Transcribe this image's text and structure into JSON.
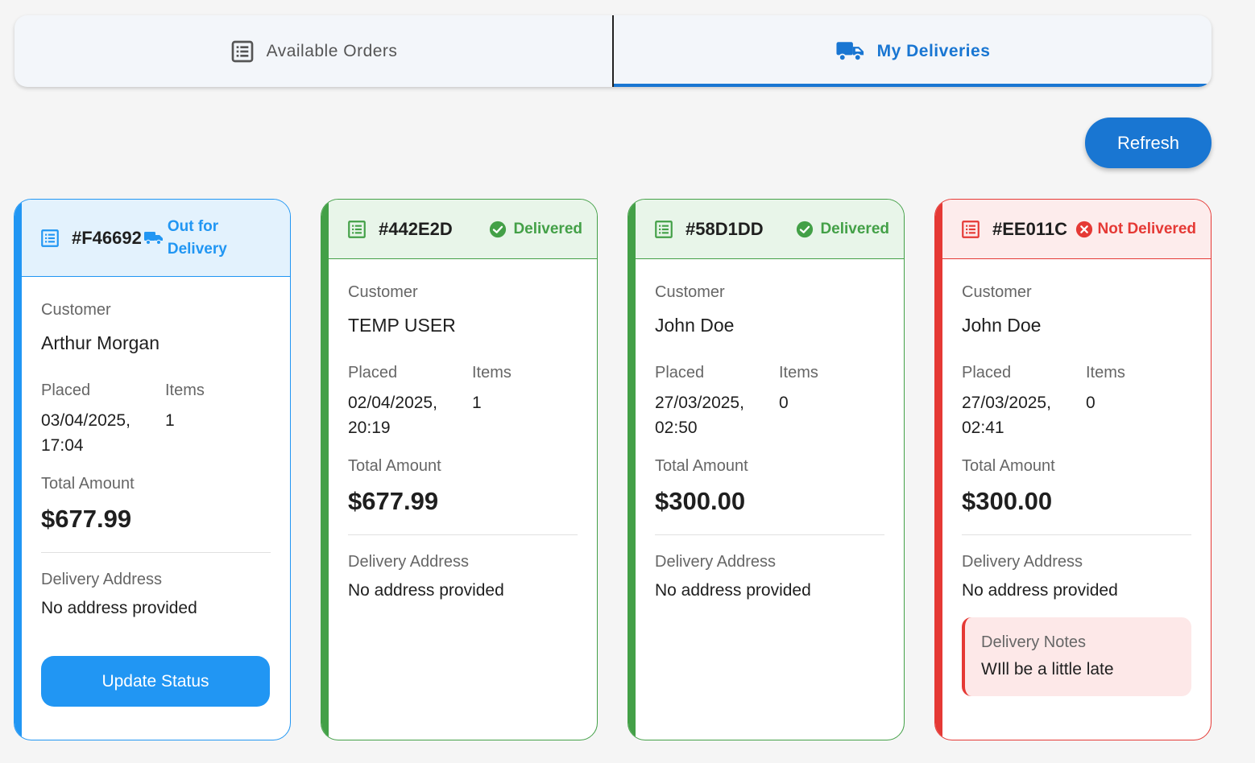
{
  "tabs": [
    {
      "label": "Available Orders",
      "icon": "list-icon",
      "active": false
    },
    {
      "label": "My Deliveries",
      "icon": "truck-icon",
      "active": true
    }
  ],
  "refresh_label": "Refresh",
  "labels": {
    "customer": "Customer",
    "placed": "Placed",
    "items": "Items",
    "total": "Total Amount",
    "address": "Delivery Address",
    "notes": "Delivery Notes"
  },
  "colors": {
    "primary": "#1976d2",
    "out_for_delivery": "#2196f3",
    "delivered": "#43a047",
    "not_delivered": "#e53935"
  },
  "orders": [
    {
      "id": "#F46692",
      "status": "Out for Delivery",
      "status_icon": "truck-icon",
      "customer": "Arthur Morgan",
      "placed_date": "03/04/2025,",
      "placed_time": "17:04",
      "items": "1",
      "total": "$677.99",
      "address": "No address provided",
      "action_label": "Update Status"
    },
    {
      "id": "#442E2D",
      "status": "Delivered",
      "status_icon": "check-circle-icon",
      "customer": "TEMP USER",
      "placed_date": "02/04/2025,",
      "placed_time": "20:19",
      "items": "1",
      "total": "$677.99",
      "address": "No address provided"
    },
    {
      "id": "#58D1DD",
      "status": "Delivered",
      "status_icon": "check-circle-icon",
      "customer": "John Doe",
      "placed_date": "27/03/2025,",
      "placed_time": "02:50",
      "items": "0",
      "total": "$300.00",
      "address": "No address provided"
    },
    {
      "id": "#EE011C",
      "status": "Not Delivered",
      "status_icon": "cancel-circle-icon",
      "customer": "John Doe",
      "placed_date": "27/03/2025,",
      "placed_time": "02:41",
      "items": "0",
      "total": "$300.00",
      "address": "No address provided",
      "notes": "WIll be a little late"
    }
  ]
}
